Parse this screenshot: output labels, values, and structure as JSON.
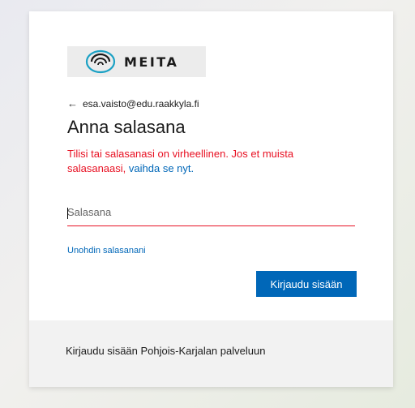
{
  "brand": {
    "logo_text": "MEITA"
  },
  "account": {
    "email": "esa.vaisto@edu.raakkyla.fi"
  },
  "page": {
    "title": "Anna salasana"
  },
  "error": {
    "message": "Tilisi tai salasanasi on virheellinen. Jos et muista salasanaasi,",
    "link_text": "vaihda se nyt."
  },
  "password": {
    "placeholder": "Salasana",
    "value": ""
  },
  "links": {
    "forgot_password": "Unohdin salasanani"
  },
  "buttons": {
    "sign_in": "Kirjaudu sisään"
  },
  "footer": {
    "text": "Kirjaudu sisään Pohjois-Karjalan palveluun"
  },
  "colors": {
    "accent": "#0067b8",
    "error": "#e81123"
  }
}
